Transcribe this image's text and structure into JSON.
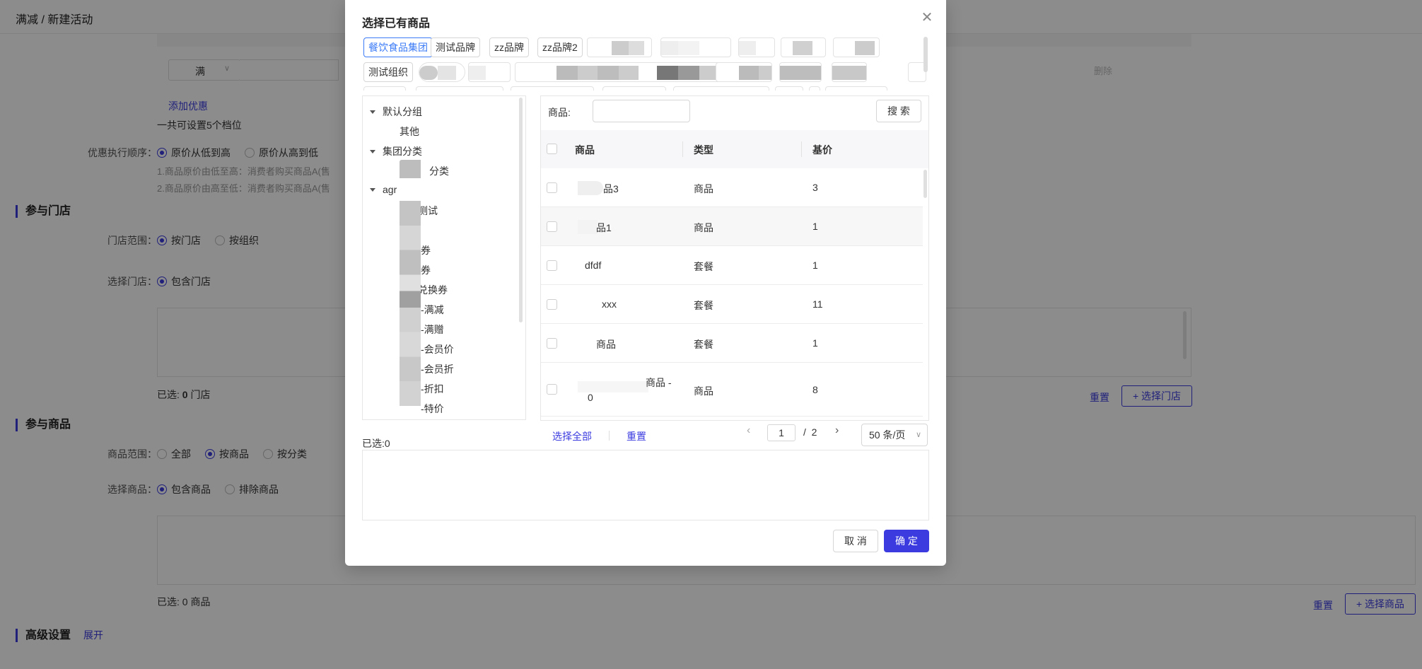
{
  "background": {
    "breadcrumb": "满减 / 新建活动",
    "tier_select": "满",
    "delete_label": "删除",
    "add_discount": "添加优惠",
    "tier_hint": "一共可设置5个档位",
    "order_label": "优惠执行顺序：",
    "order_options": [
      "原价从低到高",
      "原价从高到低"
    ],
    "order_note_1": "1.商品原价由低至高：消费者购买商品A(售",
    "order_note_2": "2.商品原价由高至低：消费者购买商品A(售",
    "section_store": "参与门店",
    "store_scope_label": "门店范围：",
    "store_scope_options": [
      "按门店",
      "按组织"
    ],
    "store_select_label": "选择门店：",
    "store_select_option": "包含门店",
    "store_selected_prefix": "已选: ",
    "store_selected_count": "0",
    "store_selected_suffix": " 门店",
    "store_reset": "重置",
    "store_choose": "+ 选择门店",
    "section_goods": "参与商品",
    "goods_scope_label": "商品范围：",
    "goods_scope_options": [
      "全部",
      "按商品",
      "按分类"
    ],
    "goods_select_label": "选择商品：",
    "goods_select_options": [
      "包含商品",
      "排除商品"
    ],
    "goods_selected": "已选: 0 商品",
    "goods_reset": "重置",
    "goods_choose": "+ 选择商品",
    "section_advanced": "高级设置",
    "expand": "展开"
  },
  "modal": {
    "title": "选择已有商品",
    "close_icon": "close-icon",
    "brand_tabs": [
      "餐饮食品集团",
      "测试品牌",
      "zz品牌",
      "zz品牌2",
      "测试组织"
    ],
    "active_brand": "餐饮食品集团",
    "tree": {
      "groups": [
        {
          "label": "默认分组",
          "children": [
            "其他"
          ]
        },
        {
          "label": "集团分类",
          "children": [
            "分类"
          ]
        },
        {
          "label": "agr",
          "children": [
            "测试",
            "券",
            "券",
            "兑换券",
            "-满减",
            "-满赠",
            "-会员价",
            "-会员折",
            "-折扣",
            "-特价"
          ]
        }
      ]
    },
    "search": {
      "label": "商品:",
      "placeholder": "",
      "button": "搜 索"
    },
    "table": {
      "columns": [
        "商品",
        "类型",
        "基价"
      ],
      "rows": [
        {
          "name": "品3",
          "type": "商品",
          "price": "3"
        },
        {
          "name": "品1",
          "type": "商品",
          "price": "1"
        },
        {
          "name": "dfdf",
          "type": "套餐",
          "price": "1"
        },
        {
          "name": "xxx",
          "type": "套餐",
          "price": "11"
        },
        {
          "name": "商品",
          "type": "套餐",
          "price": "1"
        },
        {
          "name": "商品 -",
          "name2": "0",
          "type": "商品",
          "price": "8"
        }
      ]
    },
    "selected_label": "已选:0",
    "select_all": "选择全部",
    "reset": "重置",
    "pager": {
      "prev": "‹",
      "current": "1",
      "sep": "/",
      "total": "2",
      "next": "›",
      "page_size": "50 条/页"
    },
    "cancel": "取 消",
    "confirm": "确 定"
  }
}
